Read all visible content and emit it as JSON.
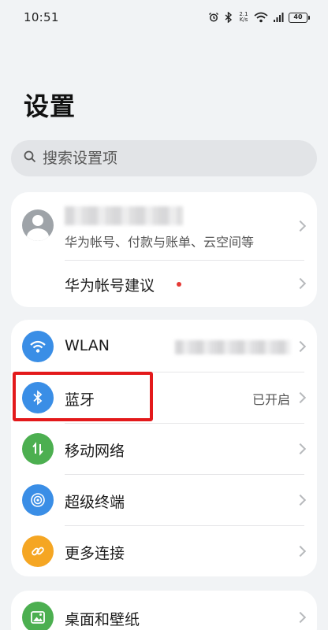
{
  "status_bar": {
    "time": "10:51",
    "net_speed_value": "2.1",
    "net_speed_unit": "K/s",
    "battery": "40",
    "icons": [
      "alarm-icon",
      "bluetooth-icon",
      "wifi-icon",
      "signal-icon",
      "battery-icon"
    ]
  },
  "page_title": "设置",
  "search": {
    "placeholder": "搜索设置项"
  },
  "account": {
    "subtitle": "华为帐号、付款与账单、云空间等",
    "suggestion_label": "华为帐号建议"
  },
  "connections": [
    {
      "label": "WLAN",
      "value": "",
      "icon": "wifi-icon",
      "color": "#3a8ee6"
    },
    {
      "label": "蓝牙",
      "value": "已开启",
      "icon": "bluetooth-icon",
      "color": "#3a8ee6"
    },
    {
      "label": "移动网络",
      "value": "",
      "icon": "mobile-data-icon",
      "color": "#4caf50"
    },
    {
      "label": "超级终端",
      "value": "",
      "icon": "super-device-icon",
      "color": "#3a8ee6"
    },
    {
      "label": "更多连接",
      "value": "",
      "icon": "link-icon",
      "color": "#f5a623"
    }
  ],
  "display": [
    {
      "label": "桌面和壁纸",
      "icon": "wallpaper-icon",
      "color": "#4caf50"
    }
  ],
  "colors": {
    "accent_blue": "#3a8ee6",
    "green": "#4caf50",
    "orange": "#f5a623",
    "highlight_red": "#e3191b",
    "notification_red": "#e53935"
  }
}
